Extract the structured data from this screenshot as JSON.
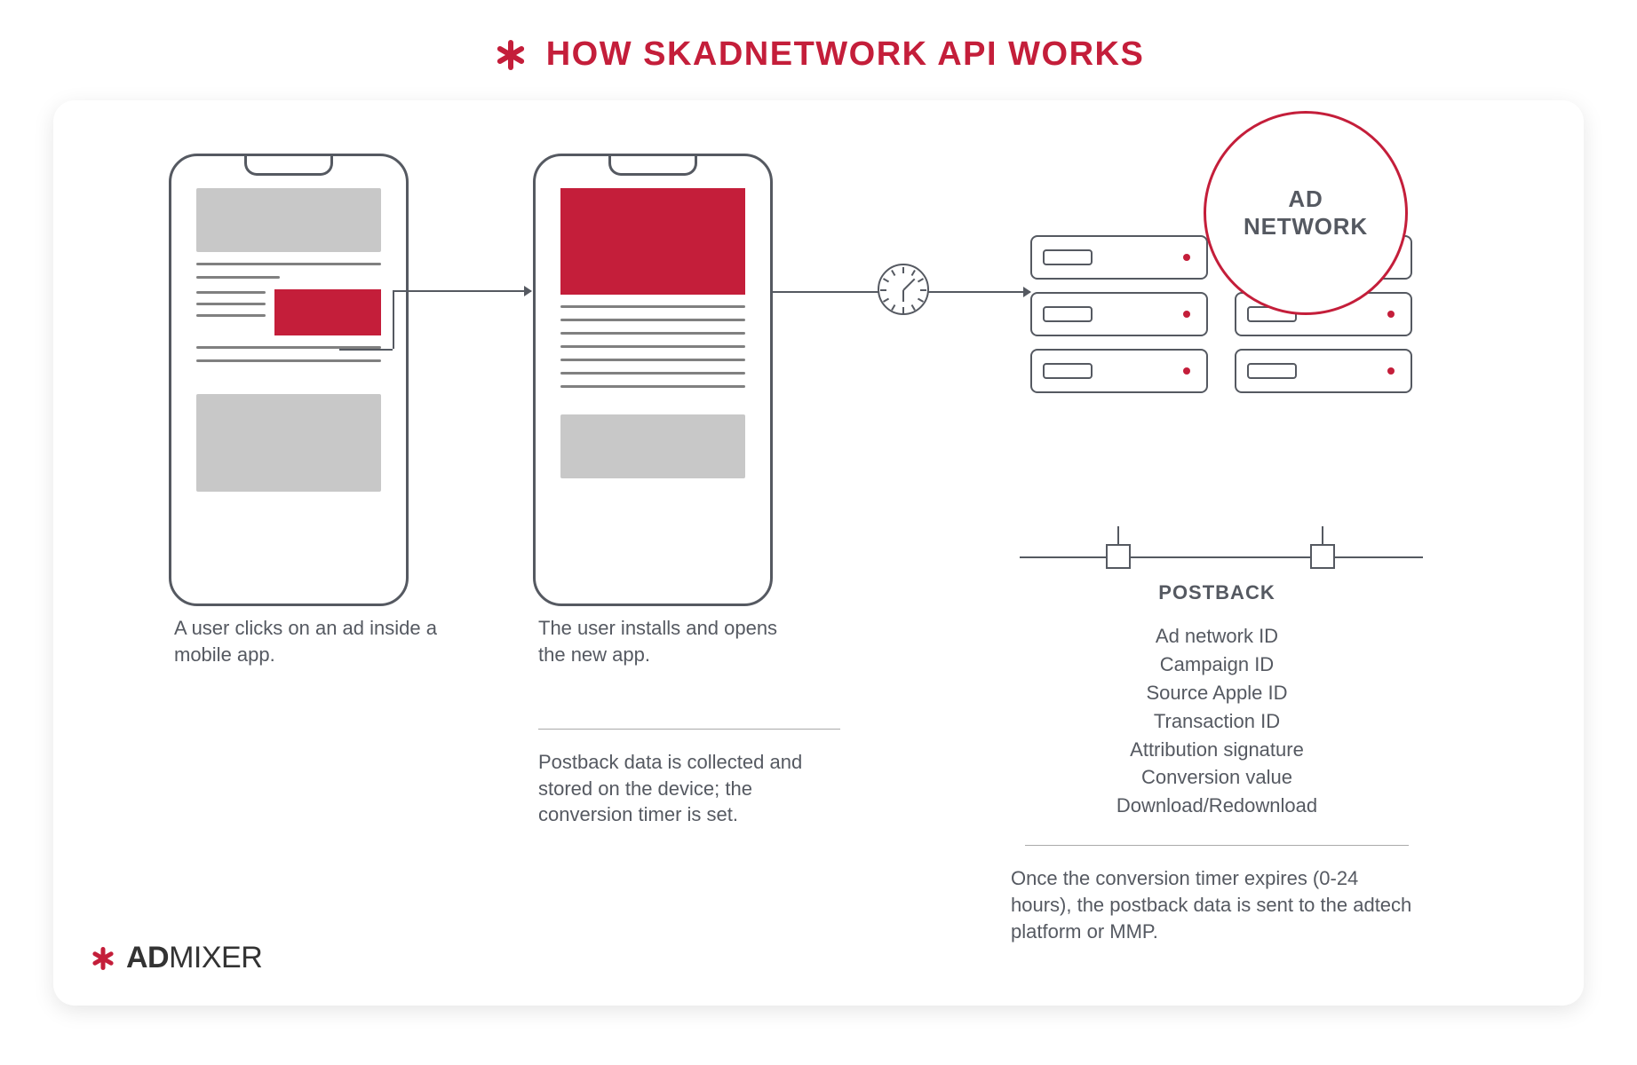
{
  "title": "HOW SKADNETWORK API WORKS",
  "circle_line1": "AD",
  "circle_line2": "NETWORK",
  "steps": {
    "step1": "A user clicks on an ad inside a mobile app.",
    "step2a": "The user installs and opens the new app.",
    "step2b": "Postback data is collected and stored on the device; the conversion timer is set."
  },
  "postback": {
    "heading": "POSTBACK",
    "items": [
      "Ad network ID",
      "Campaign ID",
      "Source Apple ID",
      "Transaction ID",
      "Attribution signature",
      "Conversion value",
      "Download/Redownload"
    ],
    "footer": "Once the conversion timer expires (0-24 hours), the postback data is sent to the adtech platform or MMP."
  },
  "brand_bold": "AD",
  "brand_rest": "MIXER"
}
